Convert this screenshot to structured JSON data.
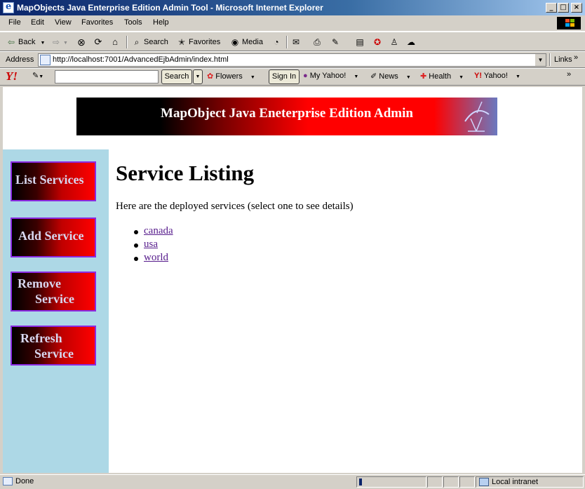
{
  "window": {
    "title": "MapObjects Java Enterprise Edition Admin Tool - Microsoft Internet Explorer"
  },
  "menu": [
    "File",
    "Edit",
    "View",
    "Favorites",
    "Tools",
    "Help"
  ],
  "toolbar": {
    "back": "Back",
    "search": "Search",
    "favorites": "Favorites",
    "media": "Media"
  },
  "address": {
    "label": "Address",
    "url": "http://localhost:7001/AdvancedEjbAdmin/index.html",
    "links": "Links"
  },
  "yahoo": {
    "search_button": "Search",
    "flowers": "Flowers",
    "sign_in": "Sign In",
    "my_yahoo": "My Yahoo!",
    "news": "News",
    "health": "Health",
    "yahoo": "Yahoo!"
  },
  "page": {
    "banner": "MapObject Java Eneterprise Edition Admin",
    "nav": [
      {
        "line1": "List Services",
        "line2": ""
      },
      {
        "line1": "Add Service",
        "line2": ""
      },
      {
        "line1": "Remove",
        "line2": "Service"
      },
      {
        "line1": "Refresh",
        "line2": "Service"
      }
    ],
    "heading": "Service Listing",
    "intro": "Here are the deployed services (select one to see details)",
    "services": [
      "canada",
      "usa",
      "world"
    ]
  },
  "status": {
    "text": "Done",
    "zone": "Local intranet"
  }
}
